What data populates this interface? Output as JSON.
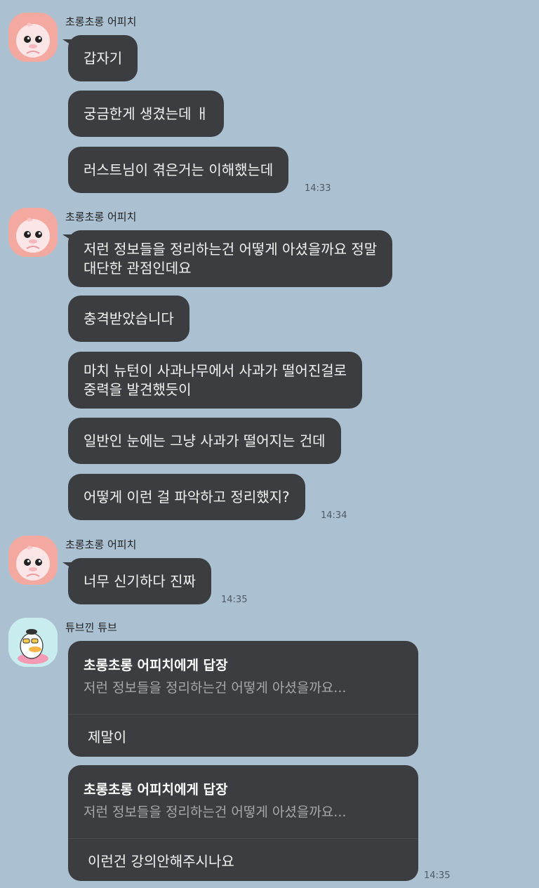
{
  "groups": [
    {
      "sender": "초롱초롱 어피치",
      "messages": [
        "갑자기",
        "궁금한게 생겼는데 ㅐ",
        "러스트님이 겪은거는 이해했는데"
      ],
      "time": "14:33"
    },
    {
      "sender": "초롱초롱 어피치",
      "messages": [
        [
          "저런 정보들을 정리하는건 어떻게 아셨을까요 정말",
          "대단한 관점인데요"
        ],
        "충격받았습니다",
        [
          "마치 뉴턴이 사과나무에서 사과가 떨어진걸로",
          "중력을 발견했듯이"
        ],
        "일반인 눈에는 그냥 사과가 떨어지는 건데",
        "어떻게 이런 걸 파악하고 정리했지?"
      ],
      "time": "14:34"
    },
    {
      "sender": "초롱초롱 어피치",
      "messages": [
        "너무 신기하다 진짜"
      ],
      "time": "14:35"
    },
    {
      "sender": "튜브낀 튜브",
      "replies": [
        {
          "quote_title": "초롱초롱 어피치에게 답장",
          "quote_text": "저런 정보들을 정리하는건 어떻게 아셨을까요...",
          "body": "제말이"
        },
        {
          "quote_title": "초롱초롱 어피치에게 답장",
          "quote_text": "저런 정보들을 정리하는건 어떻게 아셨을까요...",
          "body": "이런건 강의안해주시나요"
        }
      ],
      "time": "14:35"
    }
  ],
  "avatars": {
    "apeach": "apeach-avatar",
    "tube": "tube-avatar"
  },
  "colors": {
    "background": "#abc1d1",
    "bubble": "#3b3d40"
  }
}
